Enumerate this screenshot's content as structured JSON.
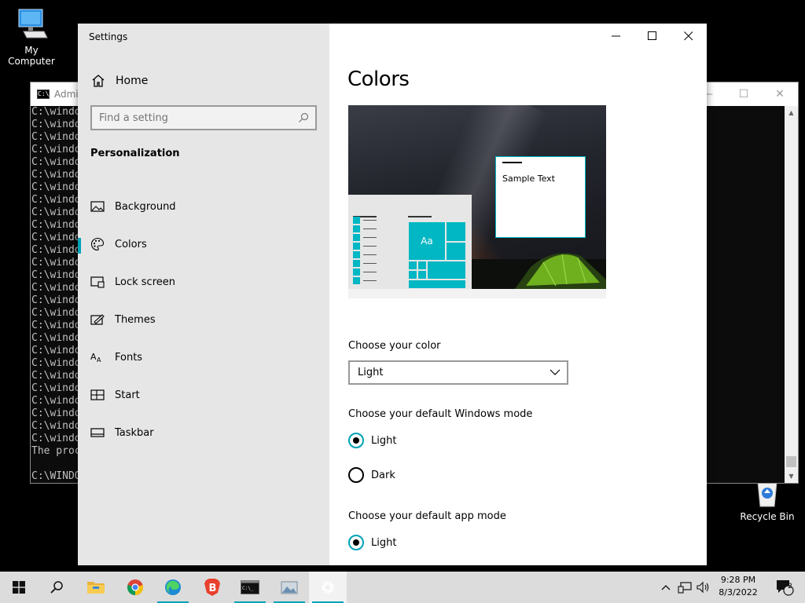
{
  "desktop": {
    "icons": [
      {
        "label": "My Computer"
      },
      {
        "label": "Recycle Bin"
      }
    ]
  },
  "console": {
    "title": "Admi",
    "icon_text": "C:\\",
    "lines": [
      "C:\\windo",
      "C:\\windo",
      "C:\\windo",
      "C:\\windo",
      "C:\\windo",
      "C:\\windo",
      "C:\\windo",
      "C:\\windo",
      "C:\\windo",
      "C:\\windo",
      "C:\\windo",
      "C:\\windo",
      "C:\\windo",
      "C:\\windo",
      "C:\\windo",
      "C:\\windo",
      "C:\\windo",
      "C:\\windo",
      "C:\\windo",
      "C:\\windo",
      "C:\\windo",
      "C:\\windo",
      "C:\\windo",
      "C:\\windo",
      "C:\\windo",
      "C:\\windo",
      "C:\\windo",
      "The proc",
      "",
      "C:\\WINDO"
    ]
  },
  "settings": {
    "app_title": "Settings",
    "home_label": "Home",
    "search": {
      "placeholder": "Find a setting",
      "value": ""
    },
    "section_heading": "Personalization",
    "nav_items": [
      {
        "label": "Background",
        "icon": "picture-icon",
        "active": false
      },
      {
        "label": "Colors",
        "icon": "palette-icon",
        "active": true
      },
      {
        "label": "Lock screen",
        "icon": "lock-screen-icon",
        "active": false
      },
      {
        "label": "Themes",
        "icon": "themes-icon",
        "active": false
      },
      {
        "label": "Fonts",
        "icon": "fonts-icon",
        "active": false
      },
      {
        "label": "Start",
        "icon": "start-icon",
        "active": false
      },
      {
        "label": "Taskbar",
        "icon": "taskbar-icon",
        "active": false
      }
    ],
    "page_title": "Colors",
    "preview": {
      "sample_text": "Sample Text",
      "tile_text": "Aa",
      "accent_color": "#00b7c3"
    },
    "choose_color_label": "Choose your color",
    "choose_color_value": "Light",
    "windows_mode_label": "Choose your default Windows mode",
    "windows_mode_options": [
      {
        "label": "Light",
        "checked": true
      },
      {
        "label": "Dark",
        "checked": false
      }
    ],
    "app_mode_label": "Choose your default app mode",
    "app_mode_options": [
      {
        "label": "Light",
        "checked": true
      }
    ]
  },
  "taskbar": {
    "time": "9:28 PM",
    "date": "8/3/2022",
    "notification_count": "2",
    "apps": [
      "start-icon",
      "search-icon",
      "file-explorer-icon",
      "chrome-icon",
      "edge-icon",
      "brave-icon",
      "terminal-icon",
      "image-app-icon",
      "settings-gear-icon"
    ]
  }
}
